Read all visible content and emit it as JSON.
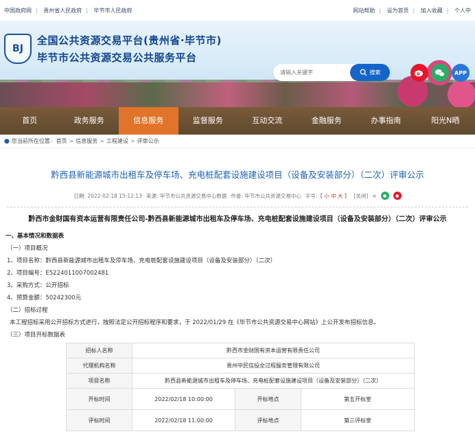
{
  "topbar": {
    "left_links": [
      "中国政府网",
      "贵州省人民政府",
      "毕节市人民政府"
    ],
    "right_links": [
      "网站帮助",
      "设为首页",
      "加入收藏",
      "个人中"
    ]
  },
  "header": {
    "title_line1": "全国公共资源交易平台(贵州省·毕节市)",
    "title_line2": "毕节市公共资源交易公共服务平台",
    "emblem_text": "BJ",
    "search_placeholder": "请输入关键字",
    "search_button": "搜索",
    "app_label": "APP"
  },
  "nav": {
    "items": [
      "首页",
      "政务服务",
      "信息服务",
      "监督服务",
      "互动交流",
      "金融服务",
      "办事指南",
      "阳光N晒"
    ],
    "active_index": 2
  },
  "breadcrumb": {
    "prefix": "您当前所在位置:",
    "items": [
      "首页",
      "信息服务",
      "工程建设",
      "评审公示"
    ]
  },
  "article": {
    "title": "黔西县新能源城市出租车及停车场、充电桩配套设施建设项目（设备及安装部分）（二次）评审公示",
    "meta_date": "日期: 2022-02-18 15:12:13",
    "meta_source": "来源: 毕节市公共资源交易中心数据",
    "meta_author": "作者: 毕节市公共资源交易中心",
    "meta_fontsize": "字号:【",
    "font_small": "小",
    "font_mid": "中",
    "font_large": "大",
    "font_close": "】",
    "meta_close": "[关闭]",
    "doc_title": "黔西市金财国有资本运营有限责任公司-黔西县新能源城市出租车及停车场、充电桩配套设施建设项目（设备及安装部分）（二次）评审公示",
    "section1": "一、基本情况和数据表",
    "sub1": "（一）项目概况",
    "item1": "1、项目名称：黔西县新能源城市出租车及停车场、充电桩配套设施建设项目（设备及安装部分）（二次）",
    "item2": "2、项目编号：E5224011007002481",
    "item3": "3、采购方式：公开招标",
    "item4": "4、预算金额：50242300元",
    "sub2": "（二）招标过程",
    "process": "本工程招标采用公开招标方式进行，按照法定公开招标程序和要求，于 2022/01/29 在《毕节市公共资源交易中心网站》上公开发布招标信息。",
    "sub3": "（三）项目开标数据表"
  },
  "table": {
    "row1_label": "招标人名称",
    "row1_value": "黔西市金财国有资本运营有限责任公司",
    "row2_label": "代理机构名称",
    "row2_value": "贵州中民信投全过程服务管理有限公司",
    "row3_label": "项目名称",
    "row3_value": "黔西县新能源城市出租车及停车场、充电桩配套设施建设项目（设备及安装部分）（二次）",
    "row4_label1": "开标时间",
    "row4_value1": "2022/02/18 10:00:00",
    "row4_label2": "开标地点",
    "row4_value2": "第五开标室",
    "row5_label1": "评标时间",
    "row5_value1": "2022/02/18 11:00:00",
    "row5_label2": "评标地点",
    "row5_value2": "第三评标室"
  },
  "colors": {
    "brand_blue": "#12448e",
    "nav_active": "#e1742a",
    "title_blue": "#1b62b6",
    "weibo_red": "#e6162d",
    "wechat_green": "#2aae67",
    "app_blue": "#2b74d8"
  }
}
